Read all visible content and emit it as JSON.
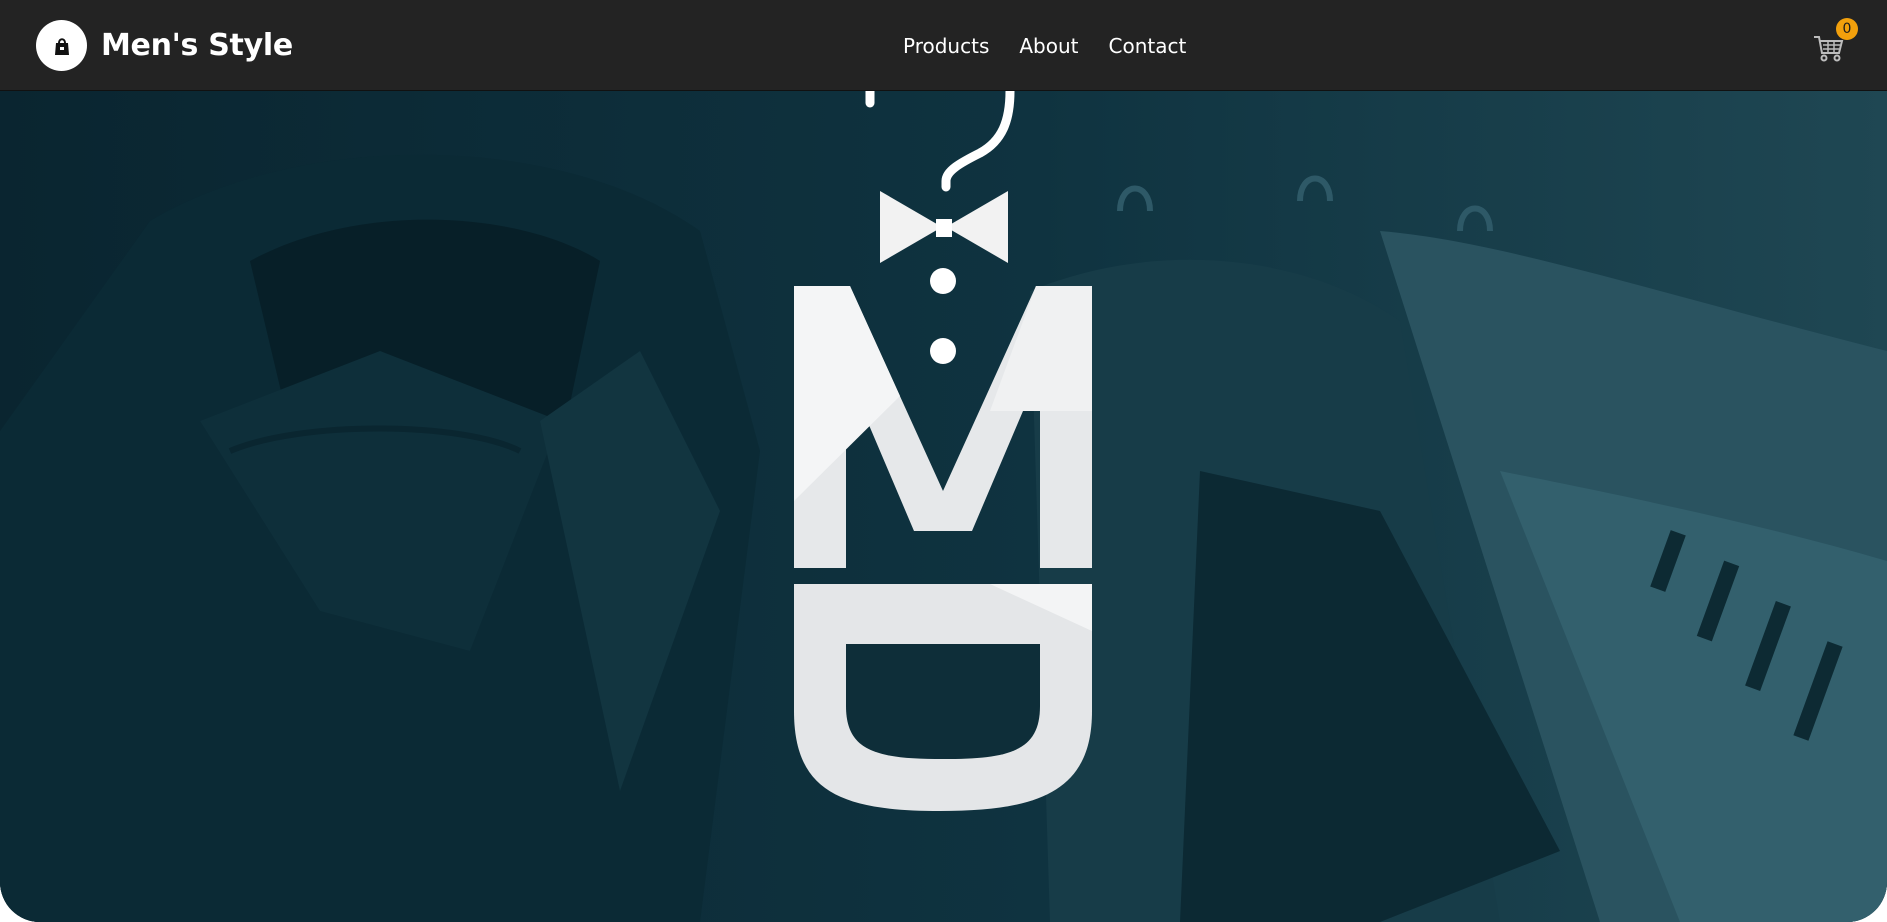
{
  "brand": {
    "name": "Men's Style",
    "logo_icon": "shopping-bag-icon"
  },
  "nav": {
    "items": [
      "Products",
      "About",
      "Contact"
    ]
  },
  "cart": {
    "icon": "cart-icon",
    "count": "0"
  },
  "hero": {
    "logo_icon": "md-hanger-bowtie-logo"
  },
  "colors": {
    "navbar": "#232323",
    "hero_overlay": "#0d2c36",
    "badge": "#f2a00c",
    "text": "#ffffff"
  }
}
